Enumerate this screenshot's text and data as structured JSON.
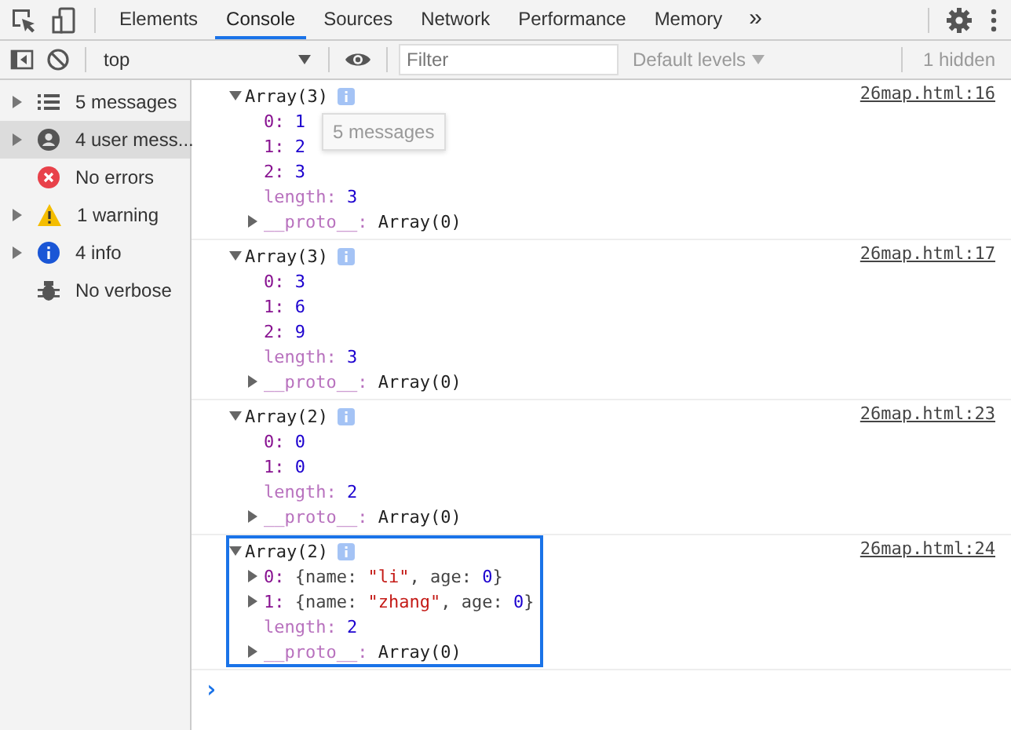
{
  "tabs": [
    {
      "label": "Elements",
      "selected": false
    },
    {
      "label": "Console",
      "selected": true
    },
    {
      "label": "Sources",
      "selected": false
    },
    {
      "label": "Network",
      "selected": false
    },
    {
      "label": "Performance",
      "selected": false
    },
    {
      "label": "Memory",
      "selected": false
    }
  ],
  "more_tabs": "»",
  "toolbar": {
    "context": "top",
    "filter_placeholder": "Filter",
    "levels": "Default levels",
    "hidden": "1 hidden"
  },
  "sidebar": {
    "items": [
      {
        "label": "5 messages",
        "kind": "messages",
        "expandable": true,
        "selected": false
      },
      {
        "label": "4 user mess...",
        "kind": "user",
        "expandable": true,
        "selected": true
      },
      {
        "label": "No errors",
        "kind": "error",
        "expandable": false,
        "selected": false
      },
      {
        "label": "1 warning",
        "kind": "warning",
        "expandable": true,
        "selected": false
      },
      {
        "label": "4 info",
        "kind": "info",
        "expandable": true,
        "selected": false
      },
      {
        "label": "No verbose",
        "kind": "verbose",
        "expandable": false,
        "selected": false
      }
    ]
  },
  "tooltip": "5 messages",
  "log": [
    {
      "header": "Array(3)",
      "source": "26map.html:16",
      "highlighted": false,
      "properties": [
        {
          "kind": "index",
          "key": "0:",
          "value": "1"
        },
        {
          "kind": "index",
          "key": "1:",
          "value": "2"
        },
        {
          "kind": "index",
          "key": "2:",
          "value": "3"
        },
        {
          "kind": "length",
          "key": "length:",
          "value": "3"
        },
        {
          "kind": "proto",
          "key": "__proto__:",
          "value": "Array(0)"
        }
      ]
    },
    {
      "header": "Array(3)",
      "source": "26map.html:17",
      "highlighted": false,
      "properties": [
        {
          "kind": "index",
          "key": "0:",
          "value": "3"
        },
        {
          "kind": "index",
          "key": "1:",
          "value": "6"
        },
        {
          "kind": "index",
          "key": "2:",
          "value": "9"
        },
        {
          "kind": "length",
          "key": "length:",
          "value": "3"
        },
        {
          "kind": "proto",
          "key": "__proto__:",
          "value": "Array(0)"
        }
      ]
    },
    {
      "header": "Array(2)",
      "source": "26map.html:23",
      "highlighted": false,
      "properties": [
        {
          "kind": "index",
          "key": "0:",
          "value": "0"
        },
        {
          "kind": "index",
          "key": "1:",
          "value": "0"
        },
        {
          "kind": "length",
          "key": "length:",
          "value": "2"
        },
        {
          "kind": "proto",
          "key": "__proto__:",
          "value": "Array(0)"
        }
      ]
    },
    {
      "header": "Array(2)",
      "source": "26map.html:24",
      "highlighted": true,
      "properties": [
        {
          "kind": "object",
          "key": "0:",
          "parts": [
            {
              "kind": "plain",
              "text": "{name:"
            },
            {
              "kind": "string",
              "text": "\"li\""
            },
            {
              "kind": "plain",
              "text": ", age:"
            },
            {
              "kind": "number",
              "text": "0"
            },
            {
              "kind": "plain",
              "text": "}"
            }
          ]
        },
        {
          "kind": "object",
          "key": "1:",
          "parts": [
            {
              "kind": "plain",
              "text": "{name:"
            },
            {
              "kind": "string",
              "text": "\"zhang\""
            },
            {
              "kind": "plain",
              "text": ", age:"
            },
            {
              "kind": "number",
              "text": "0"
            },
            {
              "kind": "plain",
              "text": "}"
            }
          ]
        },
        {
          "kind": "length",
          "key": "length:",
          "value": "2"
        },
        {
          "kind": "proto",
          "key": "__proto__:",
          "value": "Array(0)"
        }
      ]
    }
  ],
  "prompt": "›"
}
